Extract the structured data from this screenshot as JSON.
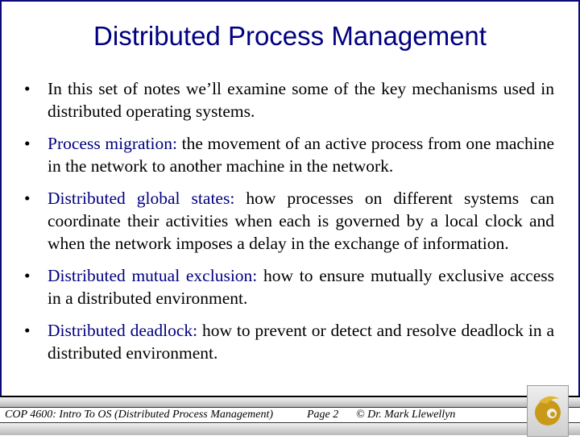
{
  "slide": {
    "title": "Distributed Process Management",
    "bullets": [
      {
        "term": "",
        "text": "In this set of notes we’ll examine some of the key mechanisms used in distributed operating systems."
      },
      {
        "term": "Process migration:",
        "text": " the movement of an active process from one machine in the network to another machine in the network."
      },
      {
        "term": "Distributed global states:",
        "text": " how processes on different systems can coordinate their activities when each is governed by a local clock and when the network imposes a delay in the exchange of information."
      },
      {
        "term": "Distributed mutual exclusion:",
        "text": " how to ensure mutually exclusive access in a distributed environment."
      },
      {
        "term": "Distributed deadlock:",
        "text": "  how to prevent or detect and resolve deadlock in a distributed environment."
      }
    ],
    "bullet_glyph": "•"
  },
  "footer": {
    "course": "COP 4600: Intro To OS  (Distributed Process Management)",
    "page": "Page 2",
    "copyright": "© Dr. Mark Llewellyn",
    "logo_icon": "pegasus-logo-icon"
  },
  "colors": {
    "title": "#000080",
    "term": "#000080",
    "frame": "#0a0a7a",
    "logo_gold": "#c99a1a"
  }
}
